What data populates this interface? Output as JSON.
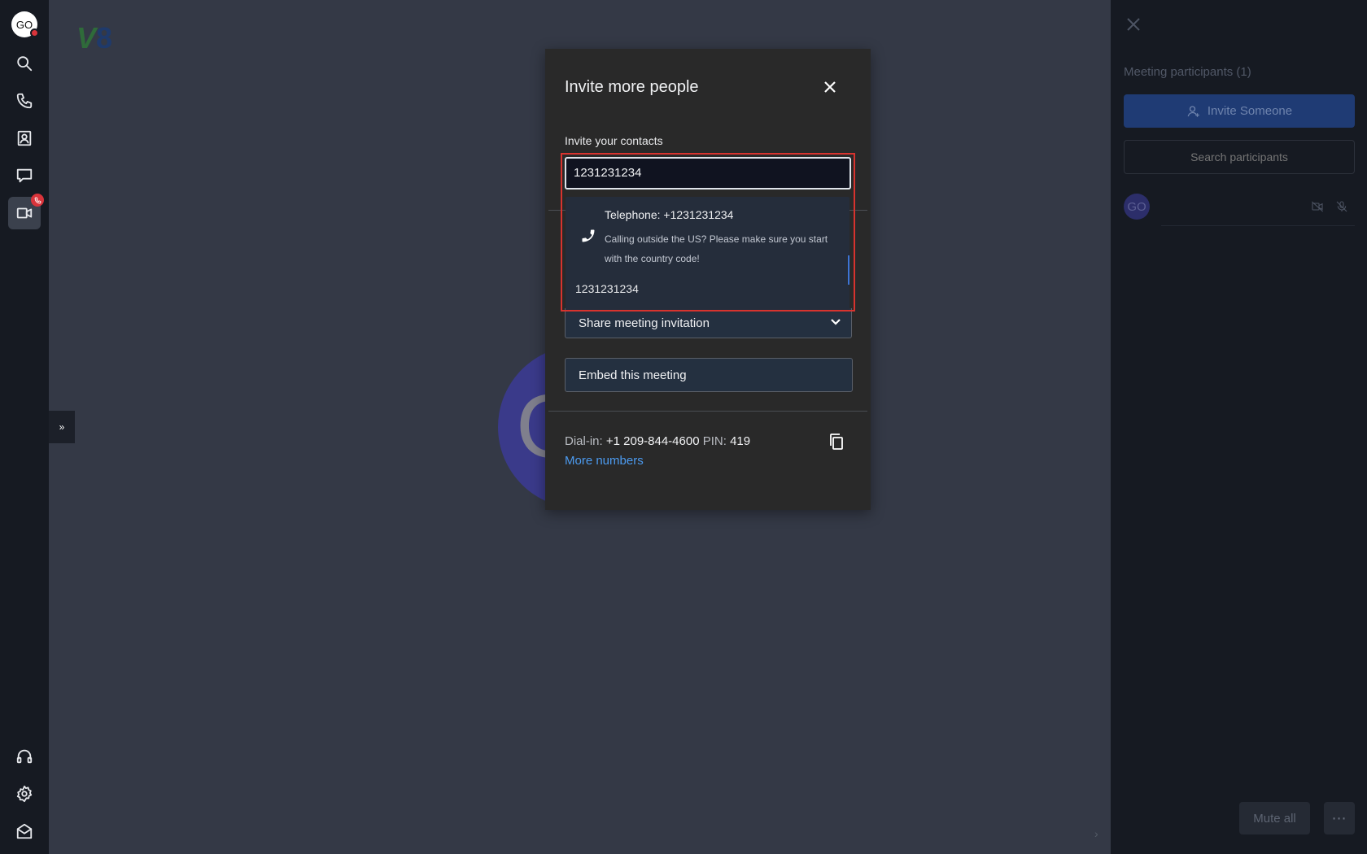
{
  "app": {
    "user_initials": "GO",
    "logo": {
      "mark": "V",
      "text": "8"
    }
  },
  "rail": {
    "items": [
      "avatar",
      "search-icon",
      "phone-icon",
      "contacts-icon",
      "chat-icon",
      "video-icon",
      "headset-icon",
      "gear-icon",
      "mail-icon"
    ],
    "active": "video-icon"
  },
  "stage": {
    "avatar_letter": "G",
    "collapse_glyph": "»"
  },
  "modal": {
    "title": "Invite more people",
    "contacts_label": "Invite your contacts",
    "input_value": "1231231234",
    "suggestion": {
      "telephone": "Telephone: +1231231234",
      "hint": "Calling outside the US? Please make sure you start with the country code!"
    },
    "suggestion_raw": "1231231234",
    "share_label": "Share meeting invitation",
    "embed_label": "Embed this meeting",
    "dialin": {
      "label": "Dial-in:",
      "number": "+1 209-844-4600",
      "pin_label": "PIN:",
      "pin": "419"
    },
    "more_numbers": "More numbers"
  },
  "participants": {
    "title": "Meeting participants (1)",
    "invite_button": "Invite Someone",
    "search_placeholder": "Search participants",
    "list": [
      {
        "initials": "GO"
      }
    ],
    "mute_all": "Mute all",
    "more": "⋯"
  },
  "colors": {
    "highlight": "#d8332e",
    "link": "#4c9bf0",
    "badge": "#d9343b"
  }
}
